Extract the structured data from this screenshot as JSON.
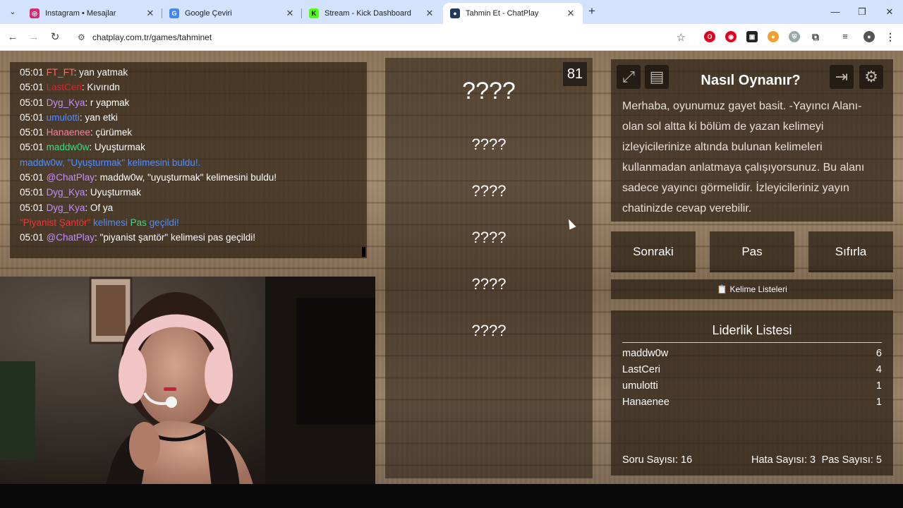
{
  "browser": {
    "tabs": [
      {
        "title": "Instagram • Mesajlar",
        "icon": "instagram-icon",
        "color": "#d62976"
      },
      {
        "title": "Google Çeviri",
        "icon": "google-translate-icon",
        "color": "#4285f4"
      },
      {
        "title": "Stream - Kick Dashboard",
        "icon": "kick-icon",
        "color": "#53fc18"
      },
      {
        "title": "Tahmin Et - ChatPlay",
        "icon": "chatplay-icon",
        "color": "#1f3a5a",
        "active": true
      }
    ],
    "url": "chatplay.com.tr/games/tahminet"
  },
  "chat": {
    "messages": [
      {
        "time": "05:01",
        "user": "FT_FT",
        "user_color": "#ff6b6b",
        "sep": ": ",
        "text": "yan yatmak"
      },
      {
        "time": "05:01",
        "user": "LastCeri",
        "user_color": "#e0202a",
        "sep": ": ",
        "text": "Kıvırıdn"
      },
      {
        "time": "05:01",
        "user": "Dyg_Kya",
        "user_color": "#c58cff",
        "sep": ": ",
        "text": "r yapmak"
      },
      {
        "time": "05:01",
        "user": "umulotti",
        "user_color": "#4f8cff",
        "sep": ": ",
        "text": "yan etki"
      },
      {
        "time": "05:01",
        "user": "Hanaenee",
        "user_color": "#ff7b9c",
        "sep": ": ",
        "text": "çürümek"
      },
      {
        "time": "05:01",
        "user": "maddw0w",
        "user_color": "#3ddc84",
        "sep": ": ",
        "text": "Uyuşturmak"
      },
      {
        "time": "",
        "user": "",
        "user_color": "#4f8cff",
        "sep": "",
        "text": "",
        "special": "maddw0w, \"Uyuşturmak\" kelimesini buldu!."
      },
      {
        "time": "05:01",
        "user": "@ChatPlay",
        "user_color": "#c58cff",
        "sep": ": ",
        "text": "maddw0w, \"uyuşturmak\" kelimesini buldu!"
      },
      {
        "time": "05:01",
        "user": "Dyg_Kya",
        "user_color": "#c58cff",
        "sep": ": ",
        "text": "Uyuşturmak"
      },
      {
        "time": "05:01",
        "user": "Dyg_Kya",
        "user_color": "#c58cff",
        "sep": ": ",
        "text": "Of ya"
      },
      {
        "time": "",
        "user": "",
        "user_color": "#ff3030",
        "sep": "",
        "text": "",
        "special2": [
          "\"Piyanist Şantör\"",
          " kelimesi ",
          "Pas",
          " geçildi!"
        ]
      },
      {
        "time": "05:01",
        "user": "@ChatPlay",
        "user_color": "#c58cff",
        "sep": ": ",
        "text": "\"piyanist şantör\" kelimesi pas geçildi!"
      }
    ]
  },
  "game": {
    "counter": "81",
    "words": [
      "????",
      "????",
      "????",
      "????",
      "????",
      "????"
    ]
  },
  "howto": {
    "title": "Nasıl Oynanır?",
    "text": "Merhaba, oyunumuz gayet basit. -Yayıncı Alanı- olan sol altta ki bölüm de yazan kelimeyi izleyicilerinize altında bulunan kelimeleri kullanmadan anlatmaya çalışıyorsunuz. Bu alanı sadece yayıncı görmelidir. İzleyicileriniz yayın chatinizde cevap verebilir."
  },
  "actions": {
    "next": "Sonraki",
    "pass": "Pas",
    "reset": "Sıfırla"
  },
  "word_lists": "📋 Kelime Listeleri",
  "leaderboard": {
    "title": "Liderlik Listesi",
    "rows": [
      {
        "name": "maddw0w",
        "score": "6"
      },
      {
        "name": "LastCeri",
        "score": "4"
      },
      {
        "name": "umulotti",
        "score": "1"
      },
      {
        "name": "Hanaenee",
        "score": "1"
      }
    ],
    "questions": "Soru Sayısı: 16",
    "errors": "Hata Sayısı: 3",
    "passes": "Pas Sayısı: 5"
  }
}
